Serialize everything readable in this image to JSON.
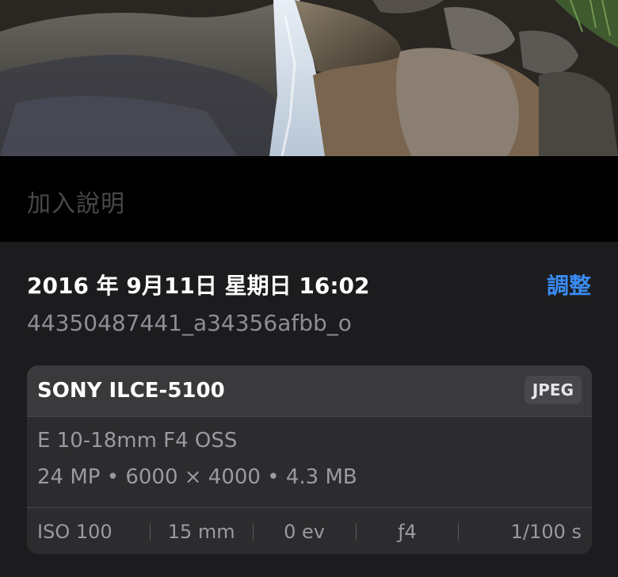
{
  "caption": {
    "placeholder": "加入說明"
  },
  "info": {
    "datetime": "2016 年 9月11日 星期日 16:02",
    "adjust_label": "調整",
    "filename": "44350487441_a34356afbb_o"
  },
  "camera": {
    "model": "SONY ILCE-5100",
    "format": "JPEG",
    "lens": "E 10-18mm F4 OSS",
    "specs": "24 MP • 6000 × 4000 • 4.3 MB",
    "exif": {
      "iso": "ISO 100",
      "focal": "15 mm",
      "ev": "0 ev",
      "aperture": "ƒ4",
      "shutter": "1/100 s"
    }
  },
  "colors": {
    "accent": "#3a8cf5",
    "panel": "#1c1c1e",
    "card": "#2c2c2e"
  }
}
